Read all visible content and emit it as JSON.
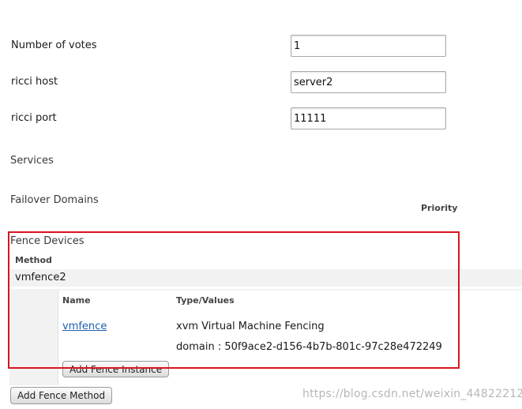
{
  "form": {
    "votes_label": "Number of votes",
    "votes_value": "1",
    "host_label": "ricci host",
    "host_value": "server2",
    "port_label": "ricci port",
    "port_value": "11111"
  },
  "services": {
    "title": "Services"
  },
  "failover": {
    "title": "Failover Domains",
    "priority_header": "Priority"
  },
  "fence": {
    "title": "Fence Devices",
    "method_header": "Method",
    "method_name": "vmfence2",
    "table": {
      "name_header": "Name",
      "type_header": "Type/Values",
      "row": {
        "name": "vmfence",
        "type": "xvm Virtual Machine Fencing",
        "value": "domain : 50f9ace2-d156-4b7b-801c-97c28e472249"
      }
    },
    "add_instance_label": "Add Fence Instance",
    "add_method_label": "Add Fence Method"
  },
  "watermark": "https://blog.csdn.net/weixin_44822212",
  "colors": {
    "highlight_box": "#d9141e",
    "link": "#1f5fae",
    "method_row_bg": "#f2f2f2"
  }
}
